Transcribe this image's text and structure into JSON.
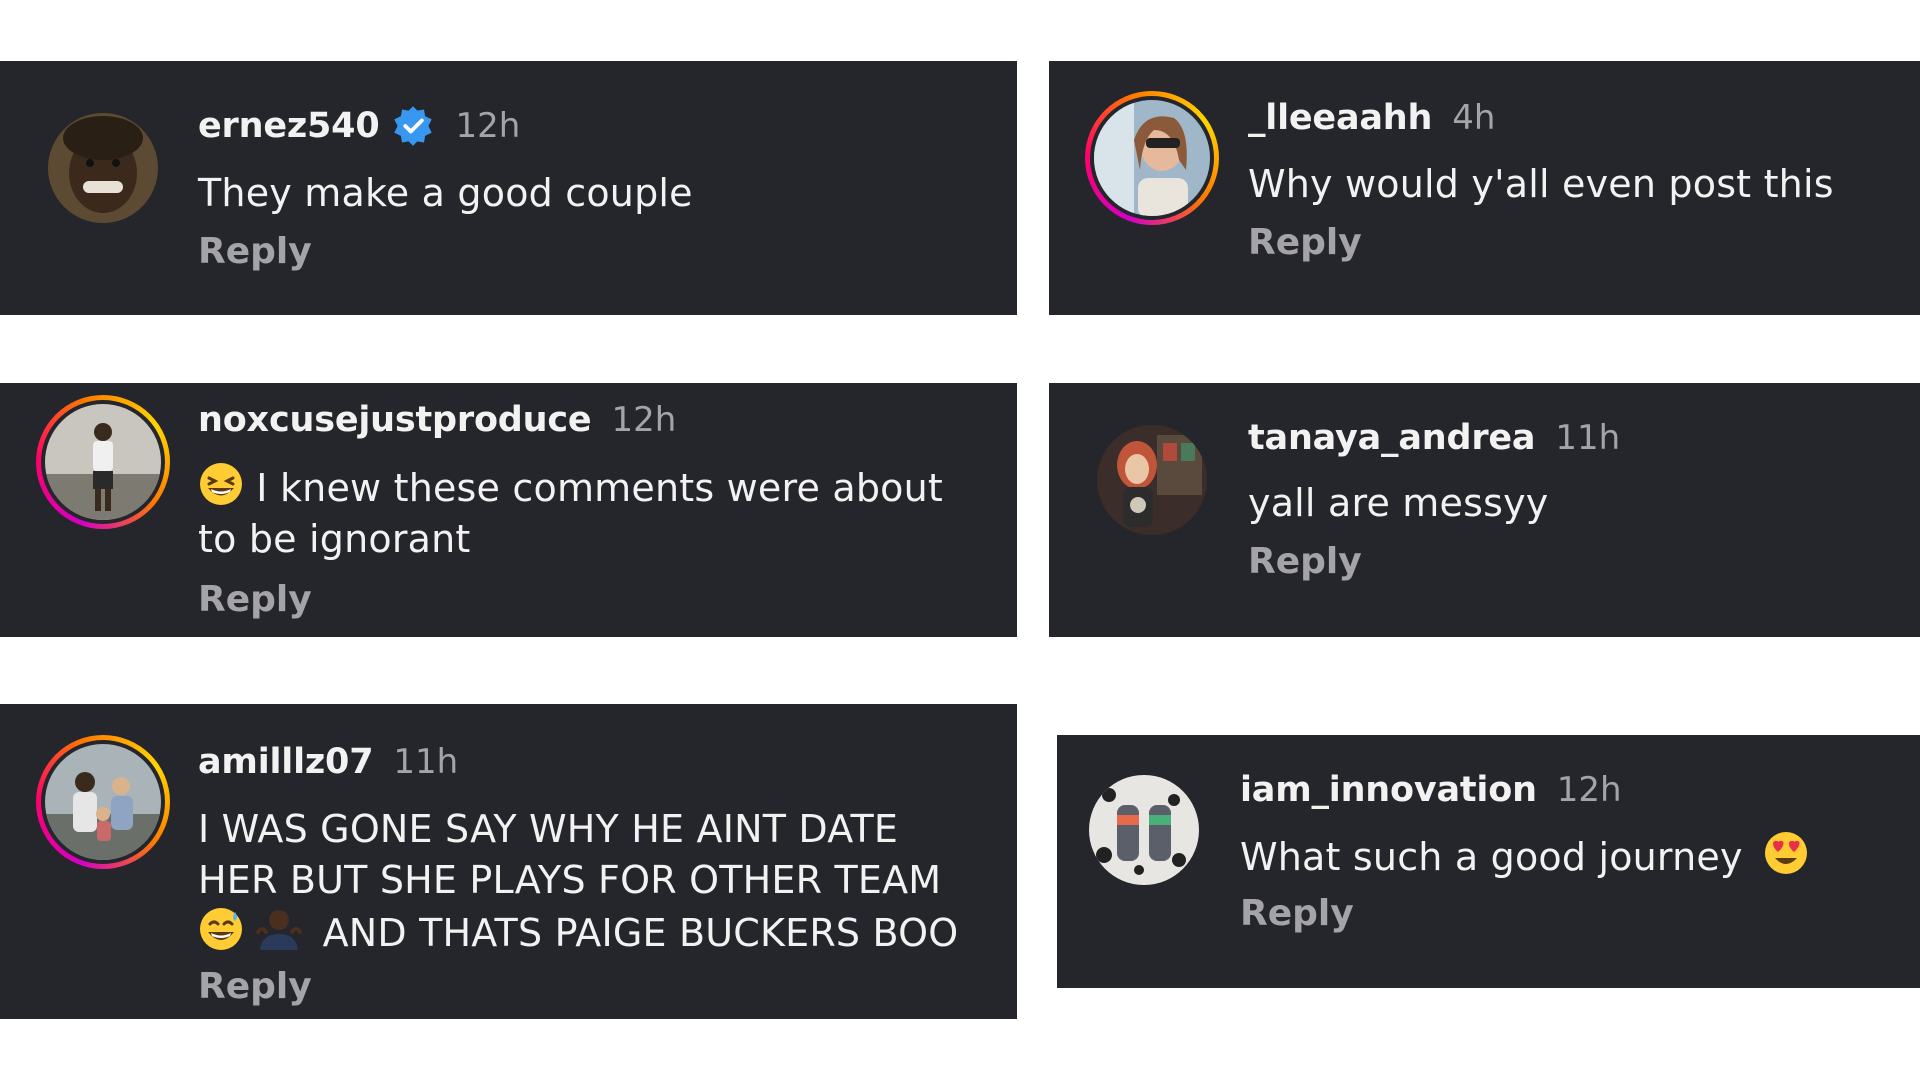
{
  "comments": [
    {
      "username": "ernez540",
      "verified": true,
      "time": "12h",
      "text": "They make a good couple",
      "reply_label": "Reply"
    },
    {
      "username": "_lleeaahh",
      "verified": false,
      "time": "4h",
      "text": "Why would y'all even post this",
      "reply_label": "Reply"
    },
    {
      "username": "noxcusejustproduce",
      "verified": false,
      "time": "12h",
      "text_line1": "I knew these comments were about",
      "text_line2": "to be ignorant",
      "emoji_start": "grinning-squinting-face",
      "reply_label": "Reply"
    },
    {
      "username": "tanaya_andrea",
      "verified": false,
      "time": "11h",
      "text": "yall are messyy",
      "reply_label": "Reply"
    },
    {
      "username": "amilllz07",
      "verified": false,
      "time": "11h",
      "text_line1": "I WAS GONE SAY WHY HE AINT DATE",
      "text_line2": "HER BUT SHE PLAYS FOR OTHER TEAM",
      "text_line3": "AND THATS PAIGE BUCKERS BOO",
      "emoji_line3": [
        "grinning-sweat-face",
        "person-shrugging"
      ],
      "reply_label": "Reply"
    },
    {
      "username": "iam_innovation",
      "verified": false,
      "time": "12h",
      "text": "What such a good journey",
      "emoji_end": "heart-eyes-face",
      "reply_label": "Reply"
    }
  ],
  "colors": {
    "card_bg": "#25262b",
    "username": "#f2f2f2",
    "muted": "#a3a3a8",
    "verified": "#3897f0",
    "story_ring": [
      "#d300c5",
      "#ff0069",
      "#ffd600"
    ]
  }
}
